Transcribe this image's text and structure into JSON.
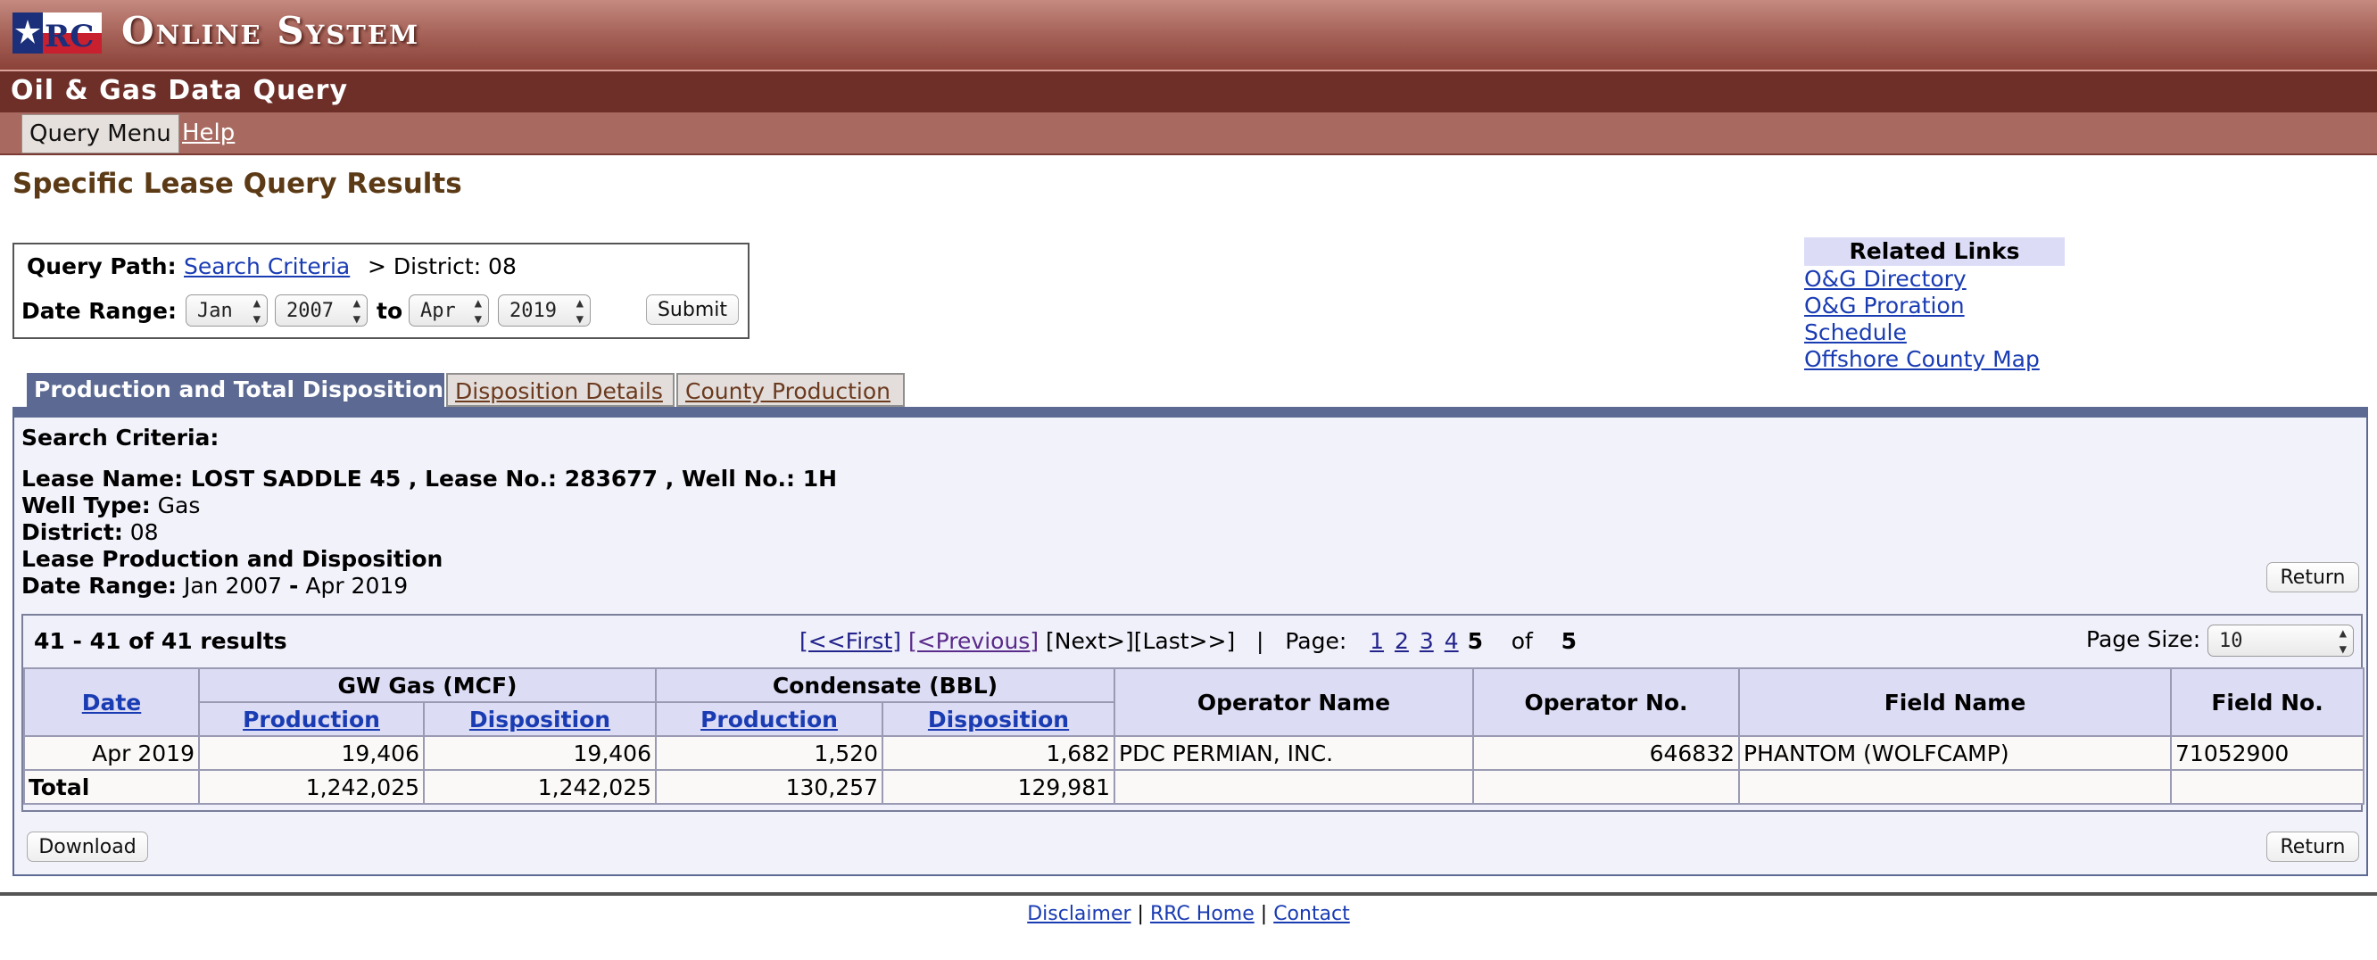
{
  "banner": {
    "title": "Online System"
  },
  "subheader": {
    "title": "Oil & Gas Data Query"
  },
  "menu": {
    "query_menu": "Query Menu",
    "help": "Help"
  },
  "page_title": "Specific Lease Query Results",
  "query_box": {
    "path_label": "Query Path:",
    "path_link": "Search Criteria",
    "path_rest": "> District: 08",
    "date_label": "Date Range:",
    "from_month": "Jan",
    "from_year": "2007",
    "to_label": "to",
    "to_month": "Apr",
    "to_year": "2019",
    "submit": "Submit"
  },
  "related_links": {
    "heading": "Related Links",
    "links": [
      "O&G Directory",
      "O&G Proration Schedule",
      "Offshore County Map"
    ]
  },
  "tabs": [
    "Production and Total Disposition",
    "Disposition Details",
    "County Production"
  ],
  "criteria": {
    "heading": "Search Criteria:",
    "lease_line": "Lease Name: LOST SADDLE 45 , Lease No.: 283677 , Well No.: 1H",
    "well_type_label": "Well Type:",
    "well_type": "Gas",
    "district_label": "District:",
    "district": "08",
    "section": "Lease Production and Disposition",
    "date_range_label": "Date Range:",
    "date_range_from": "Jan 2007",
    "date_range_sep": "-",
    "date_range_to": "Apr 2019"
  },
  "return_label": "Return",
  "download_label": "Download",
  "results": {
    "count": "41 - 41 of 41 results",
    "first": "[<<First]",
    "previous": "[<Previous]",
    "next_last": "[Next>][Last>>]",
    "sep": "|",
    "page_label": "Page:",
    "pages": [
      "1",
      "2",
      "3",
      "4"
    ],
    "current_page": "5",
    "of_label": "of",
    "total_pages": "5",
    "page_size_label": "Page Size:",
    "page_size": "10"
  },
  "table": {
    "headers": {
      "date": "Date",
      "gw_gas": "GW Gas (MCF)",
      "condensate": "Condensate (BBL)",
      "production": "Production",
      "disposition": "Disposition",
      "operator_name": "Operator Name",
      "operator_no": "Operator No.",
      "field_name": "Field Name",
      "field_no": "Field No."
    },
    "row": {
      "date": "Apr 2019",
      "gas_prod": "19,406",
      "gas_disp": "19,406",
      "cond_prod": "1,520",
      "cond_disp": "1,682",
      "operator_name": "PDC PERMIAN, INC.",
      "operator_no": "646832",
      "field_name": "PHANTOM (WOLFCAMP)",
      "field_no": "71052900"
    },
    "total": {
      "label": "Total",
      "gas_prod": "1,242,025",
      "gas_disp": "1,242,025",
      "cond_prod": "130,257",
      "cond_disp": "129,981"
    }
  },
  "footer": {
    "links": [
      "Disclaimer",
      "RRC Home",
      "Contact"
    ],
    "sep": "|"
  },
  "colors": {
    "banner": "#a8655b",
    "subbar": "#6e2f29",
    "tab_active": "#5c6a93",
    "link": "#1a3cb3"
  }
}
